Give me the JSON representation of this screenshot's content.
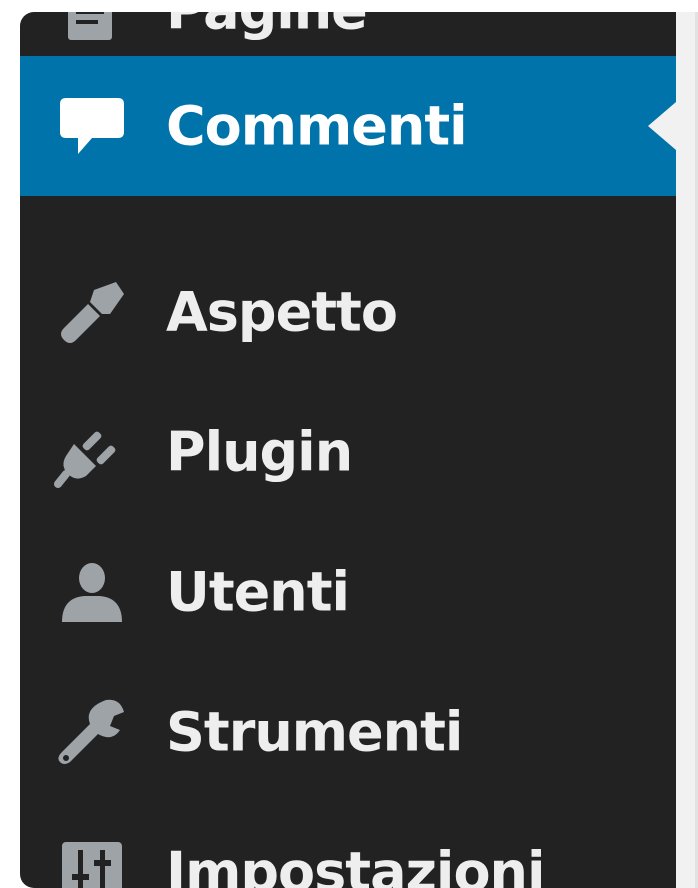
{
  "sidebar": {
    "items": [
      {
        "label": "Pagine",
        "icon": "page-icon"
      },
      {
        "label": "Commenti",
        "icon": "comment-icon",
        "current": true
      },
      {
        "label": "Aspetto",
        "icon": "paintbrush-icon"
      },
      {
        "label": "Plugin",
        "icon": "plug-icon"
      },
      {
        "label": "Utenti",
        "icon": "user-icon"
      },
      {
        "label": "Strumenti",
        "icon": "wrench-icon"
      },
      {
        "label": "Impostazioni",
        "icon": "settings-sliders-icon"
      }
    ]
  },
  "colors": {
    "menu_background": "#222222",
    "current_background": "#0073aa",
    "label": "#eeeeee",
    "icon": "#9ea3a8",
    "content_background": "#f1f1f1"
  }
}
